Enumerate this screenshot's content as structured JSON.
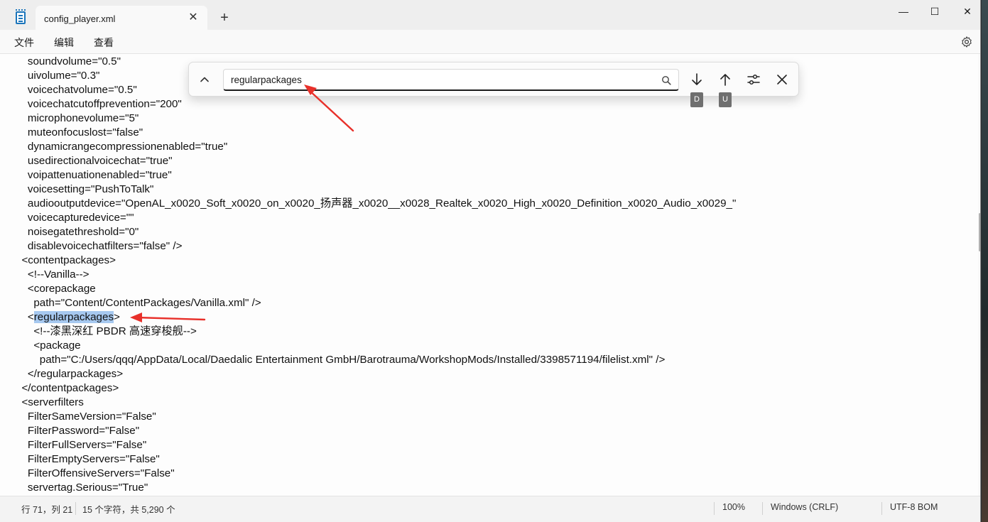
{
  "window": {
    "tab_title": "config_player.xml",
    "tab_close_glyph": "✕",
    "new_tab_glyph": "+",
    "minimize_glyph": "—",
    "maximize_glyph": "☐",
    "close_glyph": "✕"
  },
  "menu": {
    "items": [
      "文件",
      "编辑",
      "查看"
    ]
  },
  "editor": {
    "lines": [
      {
        "text": "    soundvolume=\"0.5\""
      },
      {
        "text": "    uivolume=\"0.3\""
      },
      {
        "text": "    voicechatvolume=\"0.5\""
      },
      {
        "text": "    voicechatcutoffprevention=\"200\""
      },
      {
        "text": "    microphonevolume=\"5\""
      },
      {
        "text": "    muteonfocuslost=\"false\""
      },
      {
        "text": "    dynamicrangecompressionenabled=\"true\""
      },
      {
        "text": "    usedirectionalvoicechat=\"true\""
      },
      {
        "text": "    voipattenuationenabled=\"true\""
      },
      {
        "text": "    voicesetting=\"PushToTalk\""
      },
      {
        "text": "    audiooutputdevice=\"OpenAL_x0020_Soft_x0020_on_x0020_扬声器_x0020__x0028_Realtek_x0020_High_x0020_Definition_x0020_Audio_x0029_\""
      },
      {
        "text": "    voicecapturedevice=\"\""
      },
      {
        "text": "    noisegatethreshold=\"0\""
      },
      {
        "text": "    disablevoicechatfilters=\"false\" />"
      },
      {
        "text": "  <contentpackages>"
      },
      {
        "text": "    <!--Vanilla-->"
      },
      {
        "text": "    <corepackage"
      },
      {
        "text": "      path=\"Content/ContentPackages/Vanilla.xml\" />"
      },
      {
        "pre": "    <",
        "match": "regularpackages",
        "post": ">"
      },
      {
        "text": "      <!--漆黑深红 PBDR 高速穿梭舰-->"
      },
      {
        "text": "      <package"
      },
      {
        "text": "        path=\"C:/Users/qqq/AppData/Local/Daedalic Entertainment GmbH/Barotrauma/WorkshopMods/Installed/3398571194/filelist.xml\" />"
      },
      {
        "text": "    </regularpackages>"
      },
      {
        "text": "  </contentpackages>"
      },
      {
        "text": "  <serverfilters"
      },
      {
        "text": "    FilterSameVersion=\"False\""
      },
      {
        "text": "    FilterPassword=\"False\""
      },
      {
        "text": "    FilterFullServers=\"False\""
      },
      {
        "text": "    FilterEmptyServers=\"False\""
      },
      {
        "text": "    FilterOffensiveServers=\"False\""
      },
      {
        "text": "    servertag.Serious=\"True\""
      }
    ],
    "highlight_color": "#a6c8ef"
  },
  "find": {
    "query": "regularpackages",
    "down_key": "D",
    "up_key": "U"
  },
  "status": {
    "position": "行 71，列 21",
    "selection": "15 个字符，共 5,290 个",
    "zoom": "100%",
    "line_ending": "Windows (CRLF)",
    "encoding": "UTF-8 BOM"
  },
  "colors": {
    "annotation_arrow": "#e8302a",
    "accent": "#1b75bb"
  }
}
